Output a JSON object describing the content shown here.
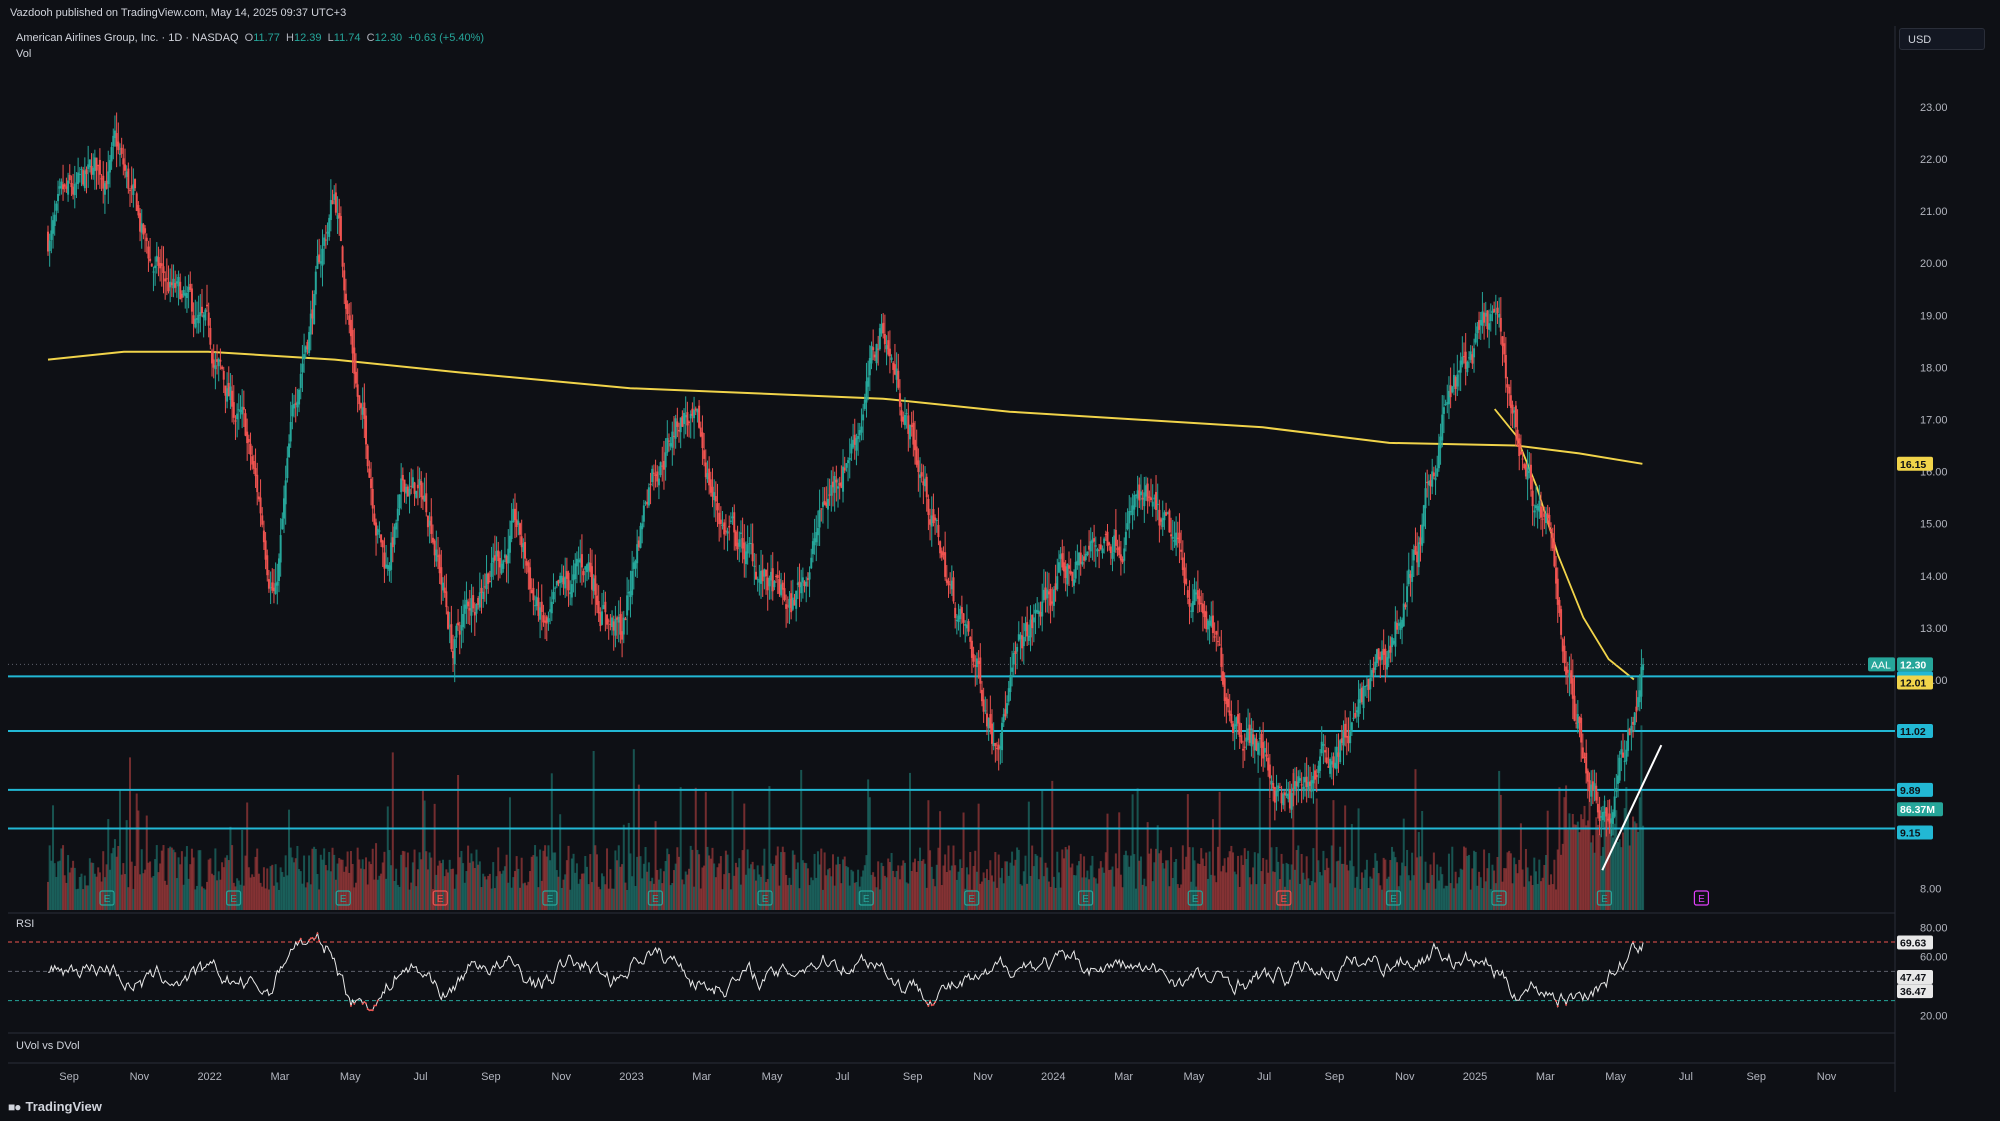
{
  "header": {
    "published_by": "Vazdooh published on TradingView.com, May 14, 2025 09:37 UTC+3"
  },
  "legend": {
    "title": "American Airlines Group, Inc. · 1D · NASDAQ",
    "o_label": "O",
    "o": "11.77",
    "h_label": "H",
    "h": "12.39",
    "l_label": "L",
    "l": "11.74",
    "c_label": "C",
    "c": "12.30",
    "change": "+0.63 (+5.40%)"
  },
  "currency": "USD",
  "panes": {
    "volume": "Vol",
    "rsi": "RSI",
    "uvol": "UVol vs DVol"
  },
  "footer": {
    "brand": "TradingView"
  },
  "colors": {
    "background": "#0e1015",
    "up": "#26a69a",
    "down": "#ef5350",
    "ma": "#f1d44a",
    "hline": "#22b8d4",
    "trendline": "#ffffff",
    "rsi_line": "#e8e8e8",
    "rsi_band": "#ef5350"
  },
  "chart_data": [
    {
      "type": "candlestick",
      "symbol": "AAL",
      "price_axis": [
        "23.00",
        "22.00",
        "21.00",
        "20.00",
        "19.00",
        "18.00",
        "17.00",
        "16.00",
        "15.00",
        "14.00",
        "13.00",
        "12.00",
        "8.00"
      ],
      "ylim": [
        7.4,
        23.9
      ],
      "x_axis": [
        "Sep",
        "Nov",
        "2022",
        "Mar",
        "May",
        "Jul",
        "Sep",
        "Nov",
        "2023",
        "Mar",
        "May",
        "Jul",
        "Sep",
        "Nov",
        "2024",
        "Mar",
        "May",
        "Jul",
        "Sep",
        "Nov",
        "2025",
        "Mar",
        "May",
        "Jul",
        "Sep",
        "Nov"
      ],
      "price_path": [
        [
          2021.62,
          20.5
        ],
        [
          2021.7,
          21.2
        ],
        [
          2021.78,
          22.1
        ],
        [
          2021.86,
          20.0
        ],
        [
          2021.92,
          19.3
        ],
        [
          2022.0,
          18.3
        ],
        [
          2022.08,
          16.8
        ],
        [
          2022.16,
          13.8
        ],
        [
          2022.22,
          18.2
        ],
        [
          2022.3,
          21.4
        ],
        [
          2022.36,
          17.2
        ],
        [
          2022.42,
          14.3
        ],
        [
          2022.47,
          15.7
        ],
        [
          2022.53,
          15.2
        ],
        [
          2022.58,
          12.6
        ],
        [
          2022.66,
          14.3
        ],
        [
          2022.73,
          14.8
        ],
        [
          2022.8,
          12.8
        ],
        [
          2022.9,
          14.2
        ],
        [
          2022.98,
          12.8
        ],
        [
          2023.05,
          16.2
        ],
        [
          2023.13,
          17.2
        ],
        [
          2023.22,
          15.0
        ],
        [
          2023.3,
          14.1
        ],
        [
          2023.38,
          13.2
        ],
        [
          2023.46,
          15.3
        ],
        [
          2023.54,
          17.0
        ],
        [
          2023.6,
          18.8
        ],
        [
          2023.68,
          16.3
        ],
        [
          2023.76,
          13.7
        ],
        [
          2023.86,
          11.2
        ],
        [
          2023.94,
          12.7
        ],
        [
          2024.0,
          13.7
        ],
        [
          2024.1,
          14.5
        ],
        [
          2024.2,
          15.4
        ],
        [
          2024.3,
          14.2
        ],
        [
          2024.36,
          13.3
        ],
        [
          2024.41,
          11.8
        ],
        [
          2024.48,
          11.0
        ],
        [
          2024.56,
          9.5
        ],
        [
          2024.64,
          10.4
        ],
        [
          2024.72,
          11.2
        ],
        [
          2024.8,
          12.6
        ],
        [
          2024.88,
          14.8
        ],
        [
          2024.93,
          17.2
        ],
        [
          2025.0,
          18.2
        ],
        [
          2025.05,
          18.8
        ],
        [
          2025.1,
          16.8
        ],
        [
          2025.18,
          14.5
        ],
        [
          2025.24,
          11.4
        ],
        [
          2025.28,
          10.2
        ],
        [
          2025.32,
          9.5
        ],
        [
          2025.36,
          10.6
        ],
        [
          2025.4,
          12.3
        ]
      ]
    },
    {
      "type": "line",
      "name": "moving-average",
      "points": [
        [
          2021.62,
          18.15
        ],
        [
          2021.8,
          18.3
        ],
        [
          2022.0,
          18.3
        ],
        [
          2022.3,
          18.15
        ],
        [
          2022.6,
          17.9
        ],
        [
          2023.0,
          17.6
        ],
        [
          2023.3,
          17.5
        ],
        [
          2023.6,
          17.4
        ],
        [
          2023.9,
          17.15
        ],
        [
          2024.2,
          17.0
        ],
        [
          2024.5,
          16.85
        ],
        [
          2024.8,
          16.55
        ],
        [
          2025.1,
          16.5
        ],
        [
          2025.25,
          16.35
        ],
        [
          2025.4,
          16.15
        ]
      ],
      "last_label": "16.15"
    },
    {
      "type": "line",
      "name": "short-moving-average",
      "points": [
        [
          2025.05,
          17.2
        ],
        [
          2025.1,
          16.7
        ],
        [
          2025.15,
          15.7
        ],
        [
          2025.2,
          14.4
        ],
        [
          2025.26,
          13.2
        ],
        [
          2025.32,
          12.4
        ],
        [
          2025.38,
          12.01
        ]
      ],
      "last_label": "12.01"
    },
    {
      "type": "hlines",
      "levels": [
        {
          "value": 12.07,
          "label": "12.07"
        },
        {
          "value": 11.02,
          "label": "11.02"
        },
        {
          "value": 9.89,
          "label": "9.89"
        },
        {
          "value": 9.15,
          "label": "9.15"
        }
      ],
      "last_price": {
        "symbol": "AAL",
        "value": 12.3,
        "label": "12.30"
      }
    },
    {
      "type": "bar",
      "name": "Vol",
      "last_label": "86.37M",
      "earnings_markers": [
        2021.76,
        2022.06,
        2022.32,
        2022.55,
        2022.81,
        2023.06,
        2023.32,
        2023.56,
        2023.81,
        2024.08,
        2024.34,
        2024.55,
        2024.81,
        2025.06,
        2025.31,
        2025.54
      ],
      "earnings_marker_label": "E"
    },
    {
      "type": "line",
      "name": "RSI",
      "axis": [
        "80.00",
        "60.00",
        "20.00"
      ],
      "ylim": [
        10,
        85
      ],
      "band_upper": 70,
      "band_lower": 30,
      "labels": [
        "69.63",
        "47.47",
        "36.47"
      ],
      "last_value": 69.63
    }
  ]
}
